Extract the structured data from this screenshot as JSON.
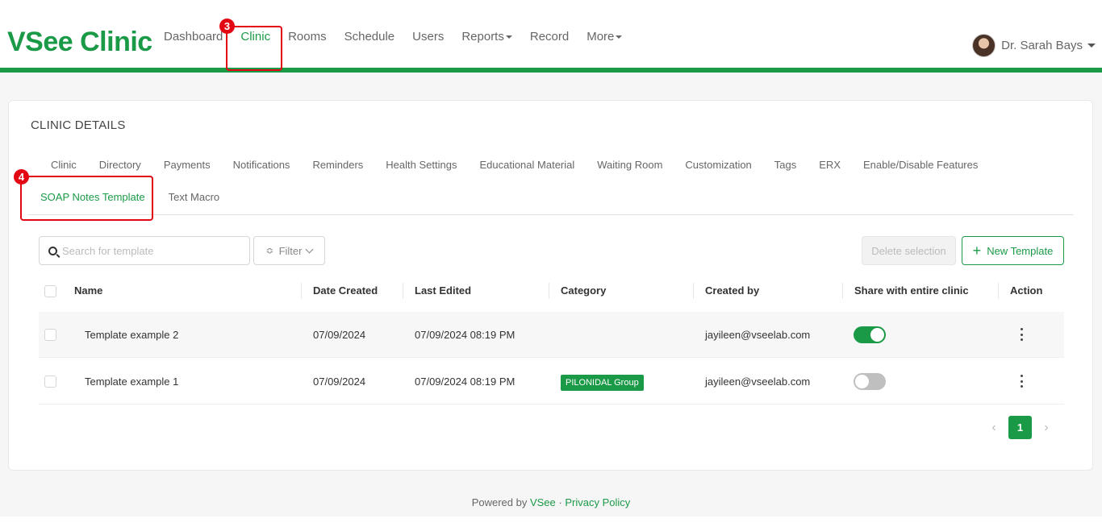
{
  "header": {
    "logo": "VSee Clinic",
    "nav": [
      {
        "label": "Dashboard"
      },
      {
        "label": "Clinic"
      },
      {
        "label": "Rooms"
      },
      {
        "label": "Schedule"
      },
      {
        "label": "Users"
      },
      {
        "label": "Reports"
      },
      {
        "label": "Record"
      },
      {
        "label": "More"
      }
    ],
    "user_name": "Dr. Sarah Bays",
    "accent_color": "#1a9a47"
  },
  "annotations": {
    "badge_clinic": "3",
    "badge_soap": "4"
  },
  "card": {
    "title": "CLINIC DETAILS",
    "tabs_row1": [
      "Clinic",
      "Directory",
      "Payments",
      "Notifications",
      "Reminders",
      "Health Settings",
      "Educational Material",
      "Waiting Room",
      "Customization",
      "Tags",
      "ERX",
      "Enable/Disable Features"
    ],
    "tabs_row2": [
      "SOAP Notes Template",
      "Text Macro"
    ]
  },
  "toolbar": {
    "search_placeholder": "Search for template",
    "filter_label": "Filter",
    "delete_label": "Delete selection",
    "new_label": "New Template"
  },
  "table": {
    "columns": [
      "Name",
      "Date Created",
      "Last Edited",
      "Category",
      "Created by",
      "Share with entire clinic",
      "Action"
    ],
    "rows": [
      {
        "name": "Template example 2",
        "date_created": "07/09/2024",
        "last_edited": "07/09/2024 08:19 PM",
        "category": "",
        "created_by": "jayileen@vseelab.com",
        "shared": true
      },
      {
        "name": "Template example 1",
        "date_created": "07/09/2024",
        "last_edited": "07/09/2024 08:19 PM",
        "category": "PILONIDAL Group",
        "created_by": "jayileen@vseelab.com",
        "shared": false
      }
    ]
  },
  "pagination": {
    "prev": "‹",
    "current": "1",
    "next": "›"
  },
  "footer": {
    "prefix": "Powered by",
    "brand": "VSee",
    "separator": "·",
    "privacy": "Privacy Policy"
  }
}
